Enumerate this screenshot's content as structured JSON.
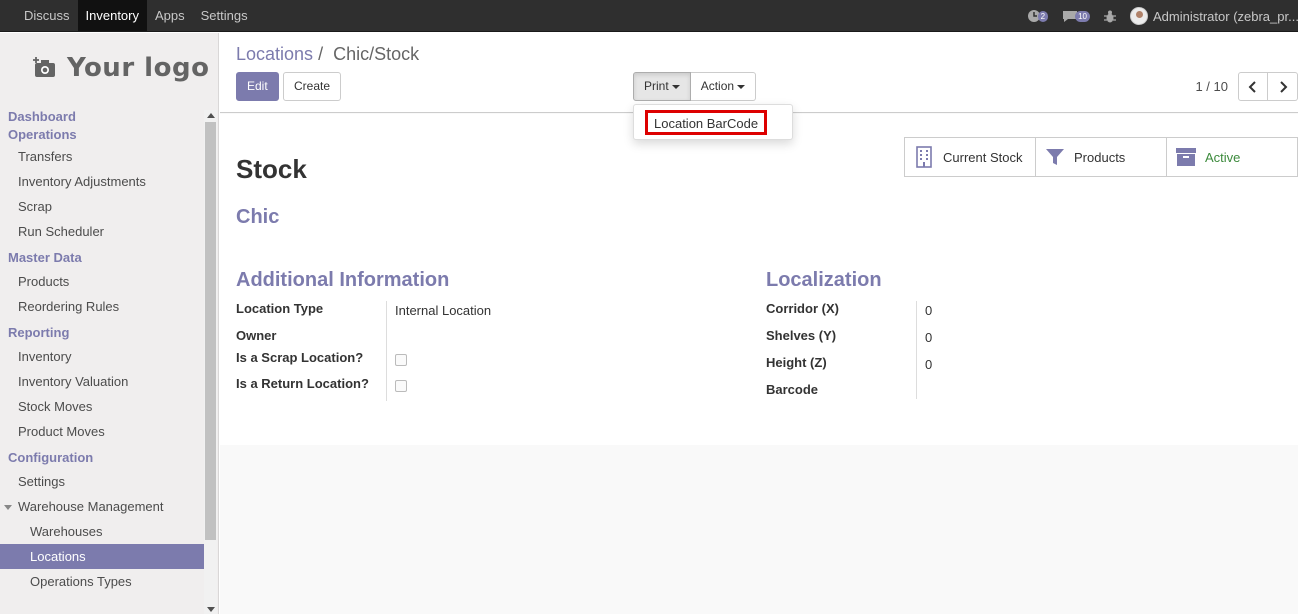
{
  "topbar": {
    "menu": [
      "Discuss",
      "Inventory",
      "Apps",
      "Settings"
    ],
    "active_menu": "Inventory",
    "activity_count": "2",
    "messages_count": "10",
    "user": "Administrator (zebra_pr..."
  },
  "sidebar": {
    "logo_text": "Your logo",
    "sections": {
      "dashboard": "Dashboard",
      "operations": "Operations",
      "master_data": "Master Data",
      "reporting": "Reporting",
      "configuration": "Configuration"
    },
    "items": {
      "transfers": "Transfers",
      "inventory_adjustments": "Inventory Adjustments",
      "scrap": "Scrap",
      "run_scheduler": "Run Scheduler",
      "products": "Products",
      "reordering_rules": "Reordering Rules",
      "inventory": "Inventory",
      "inventory_valuation": "Inventory Valuation",
      "stock_moves": "Stock Moves",
      "product_moves": "Product Moves",
      "settings": "Settings",
      "warehouse_management": "Warehouse Management",
      "warehouses": "Warehouses",
      "locations": "Locations",
      "operations_types": "Operations Types"
    },
    "selected": "Locations"
  },
  "control": {
    "breadcrumb_parent": "Locations",
    "breadcrumb_sep": "/",
    "breadcrumb_current": "Chic/Stock",
    "edit_label": "Edit",
    "create_label": "Create",
    "print_label": "Print",
    "action_label": "Action",
    "print_menu_item": "Location BarCode",
    "pager": "1 / 10"
  },
  "stats": {
    "current_stock": "Current Stock",
    "products": "Products",
    "active": "Active"
  },
  "form": {
    "name": "Stock",
    "parent": "Chic",
    "additional_info_title": "Additional Information",
    "localization_title": "Localization",
    "location_type_label": "Location Type",
    "location_type_value": "Internal Location",
    "owner_label": "Owner",
    "scrap_label": "Is a Scrap Location?",
    "return_label": "Is a Return Location?",
    "corridor_label": "Corridor (X)",
    "corridor_value": "0",
    "shelves_label": "Shelves (Y)",
    "shelves_value": "0",
    "height_label": "Height (Z)",
    "height_value": "0",
    "barcode_label": "Barcode"
  },
  "colors": {
    "brand": "#7c7bad",
    "navbar": "#2f2f2f",
    "highlight": "#dd0000",
    "active": "#3c8a3c"
  }
}
